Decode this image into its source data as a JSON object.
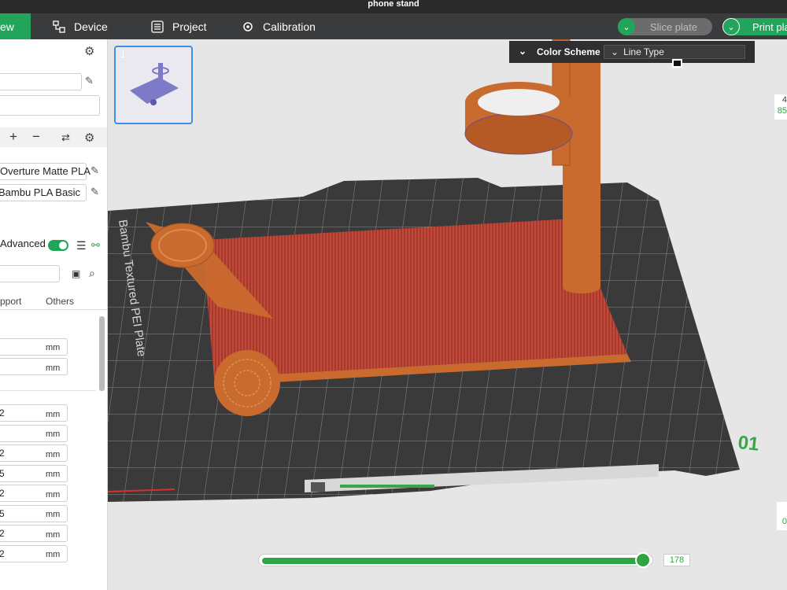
{
  "window": {
    "title": "phone stand"
  },
  "topbar": {
    "tabs": [
      {
        "label": "ew",
        "icon": "preview-icon"
      },
      {
        "label": "Device",
        "icon": "device-icon"
      },
      {
        "label": "Project",
        "icon": "project-icon"
      },
      {
        "label": "Calibration",
        "icon": "calibration-icon"
      }
    ],
    "slice_label": "Slice plate",
    "print_label": "Print pla"
  },
  "sidebar": {
    "filaments": [
      "Overture Matte PLA",
      "Bambu PLA Basic"
    ],
    "advanced_label": "Advanced",
    "advanced_on": true,
    "tabs": [
      "pport",
      "Others"
    ],
    "unit": "mm",
    "values": [
      "",
      "",
      "2",
      "",
      "2",
      "5",
      "2",
      "5",
      "2",
      "2"
    ]
  },
  "viewport": {
    "plate_number": "1",
    "color_scheme_label": "Color Scheme",
    "color_scheme_value": "Line Type",
    "bed_label": "Bambu Textured PEI Plate",
    "bed_number": "01",
    "right_top_values": [
      "4",
      "85"
    ],
    "right_bottom_value": "0",
    "layer_value": "178",
    "layer_progress": 0.98
  },
  "colors": {
    "accent": "#22a55a",
    "model": "#c96a2e",
    "bed": "#3c3c3c",
    "infill": "#c0463a"
  }
}
